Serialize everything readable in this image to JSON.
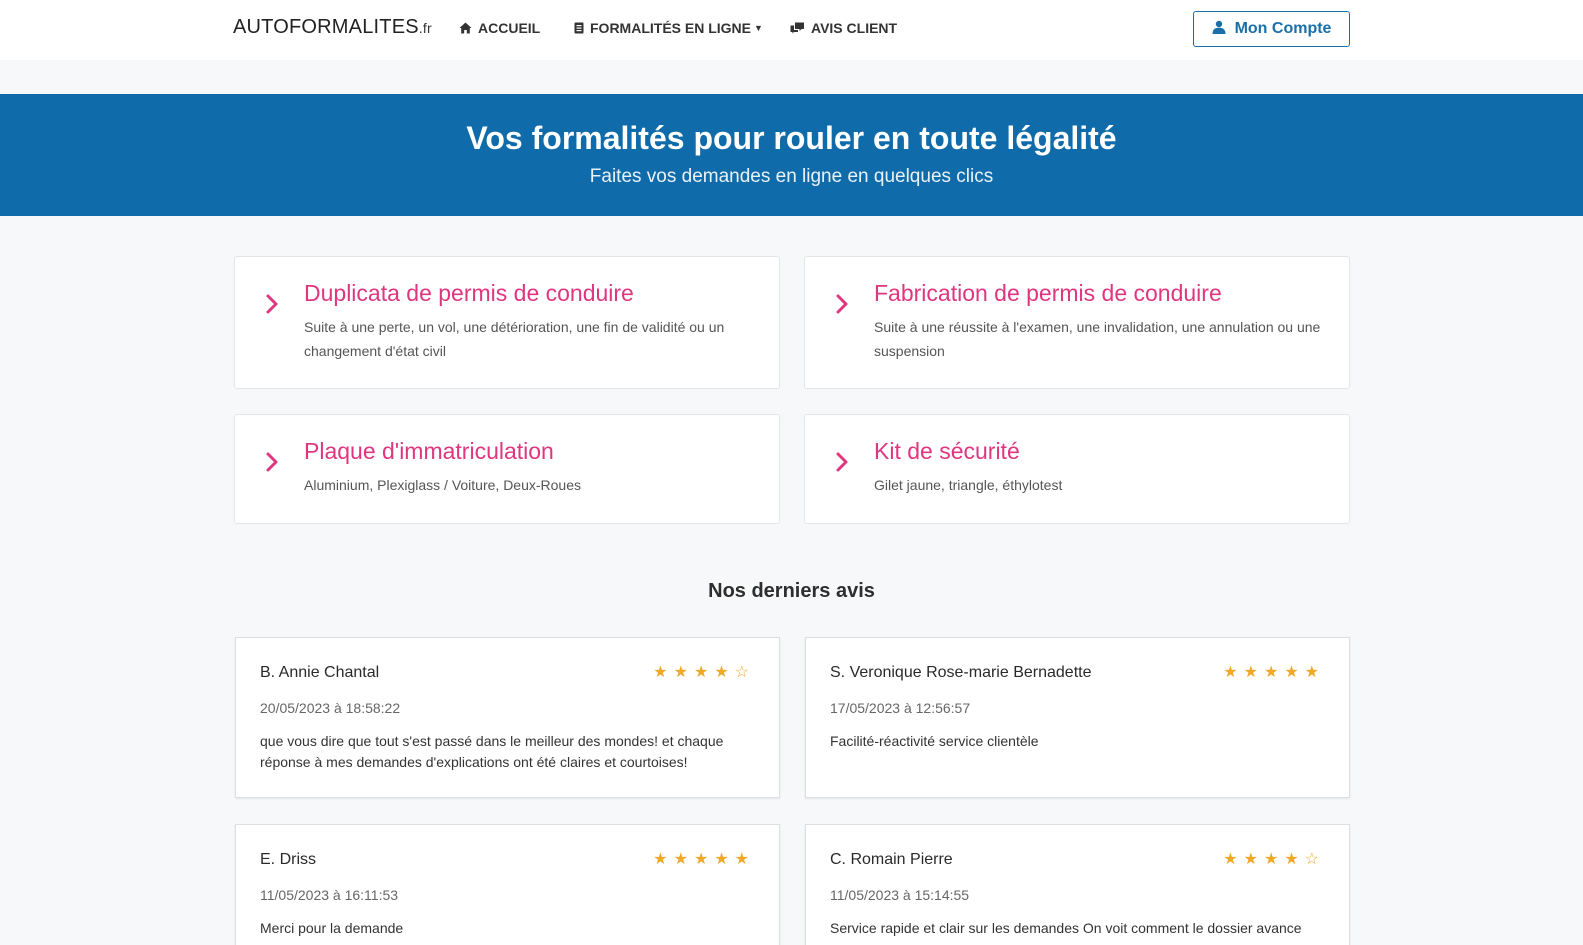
{
  "brand": {
    "name": "AUTOFORMALITES",
    "tld": ".fr"
  },
  "nav": {
    "home": "ACCUEIL",
    "formalites": "FORMALITÉS EN LIGNE",
    "avis": "AVIS CLIENT",
    "account": "Mon Compte"
  },
  "hero": {
    "title": "Vos formalités pour rouler en toute légalité",
    "subtitle": "Faites vos demandes en ligne en quelques clics"
  },
  "services": [
    {
      "title": "Duplicata de permis de conduire",
      "desc": "Suite à une perte, un vol, une détérioration, une fin de validité ou un changement d'état civil"
    },
    {
      "title": "Fabrication de permis de conduire",
      "desc": "Suite à une réussite à l'examen, une invalidation, une annulation ou une suspension"
    },
    {
      "title": "Plaque d'immatriculation",
      "desc": "Aluminium, Plexiglass / Voiture, Deux-Roues"
    },
    {
      "title": "Kit de sécurité",
      "desc": "Gilet jaune, triangle, éthylotest"
    }
  ],
  "reviews_section": {
    "title": "Nos derniers avis"
  },
  "reviews": [
    {
      "name": "B. Annie Chantal",
      "rating": 4,
      "date": "20/05/2023 à 18:58:22",
      "text": "que vous dire que tout s'est passé dans le meilleur des mondes! et chaque réponse à mes demandes d'explications ont été claires et courtoises!"
    },
    {
      "name": "S. Veronique Rose-marie Bernadette",
      "rating": 5,
      "date": "17/05/2023 à 12:56:57",
      "text": "Facilité-réactivité service clientèle"
    },
    {
      "name": "E. Driss",
      "rating": 5,
      "date": "11/05/2023 à 16:11:53",
      "text": "Merci pour la demande"
    },
    {
      "name": "C. Romain Pierre",
      "rating": 4,
      "date": "11/05/2023 à 15:14:55",
      "text": "Service rapide et clair sur les demandes On voit comment le dossier avance"
    }
  ],
  "colors": {
    "primary": "#0f6ba9",
    "accent": "#e0357f",
    "star": "#f0a829"
  },
  "icons": {
    "home": "home-icon",
    "formalites": "document-icon",
    "avis": "comments-icon",
    "account": "user-icon",
    "service": "chevron-right-icon",
    "star": "star-icon"
  }
}
